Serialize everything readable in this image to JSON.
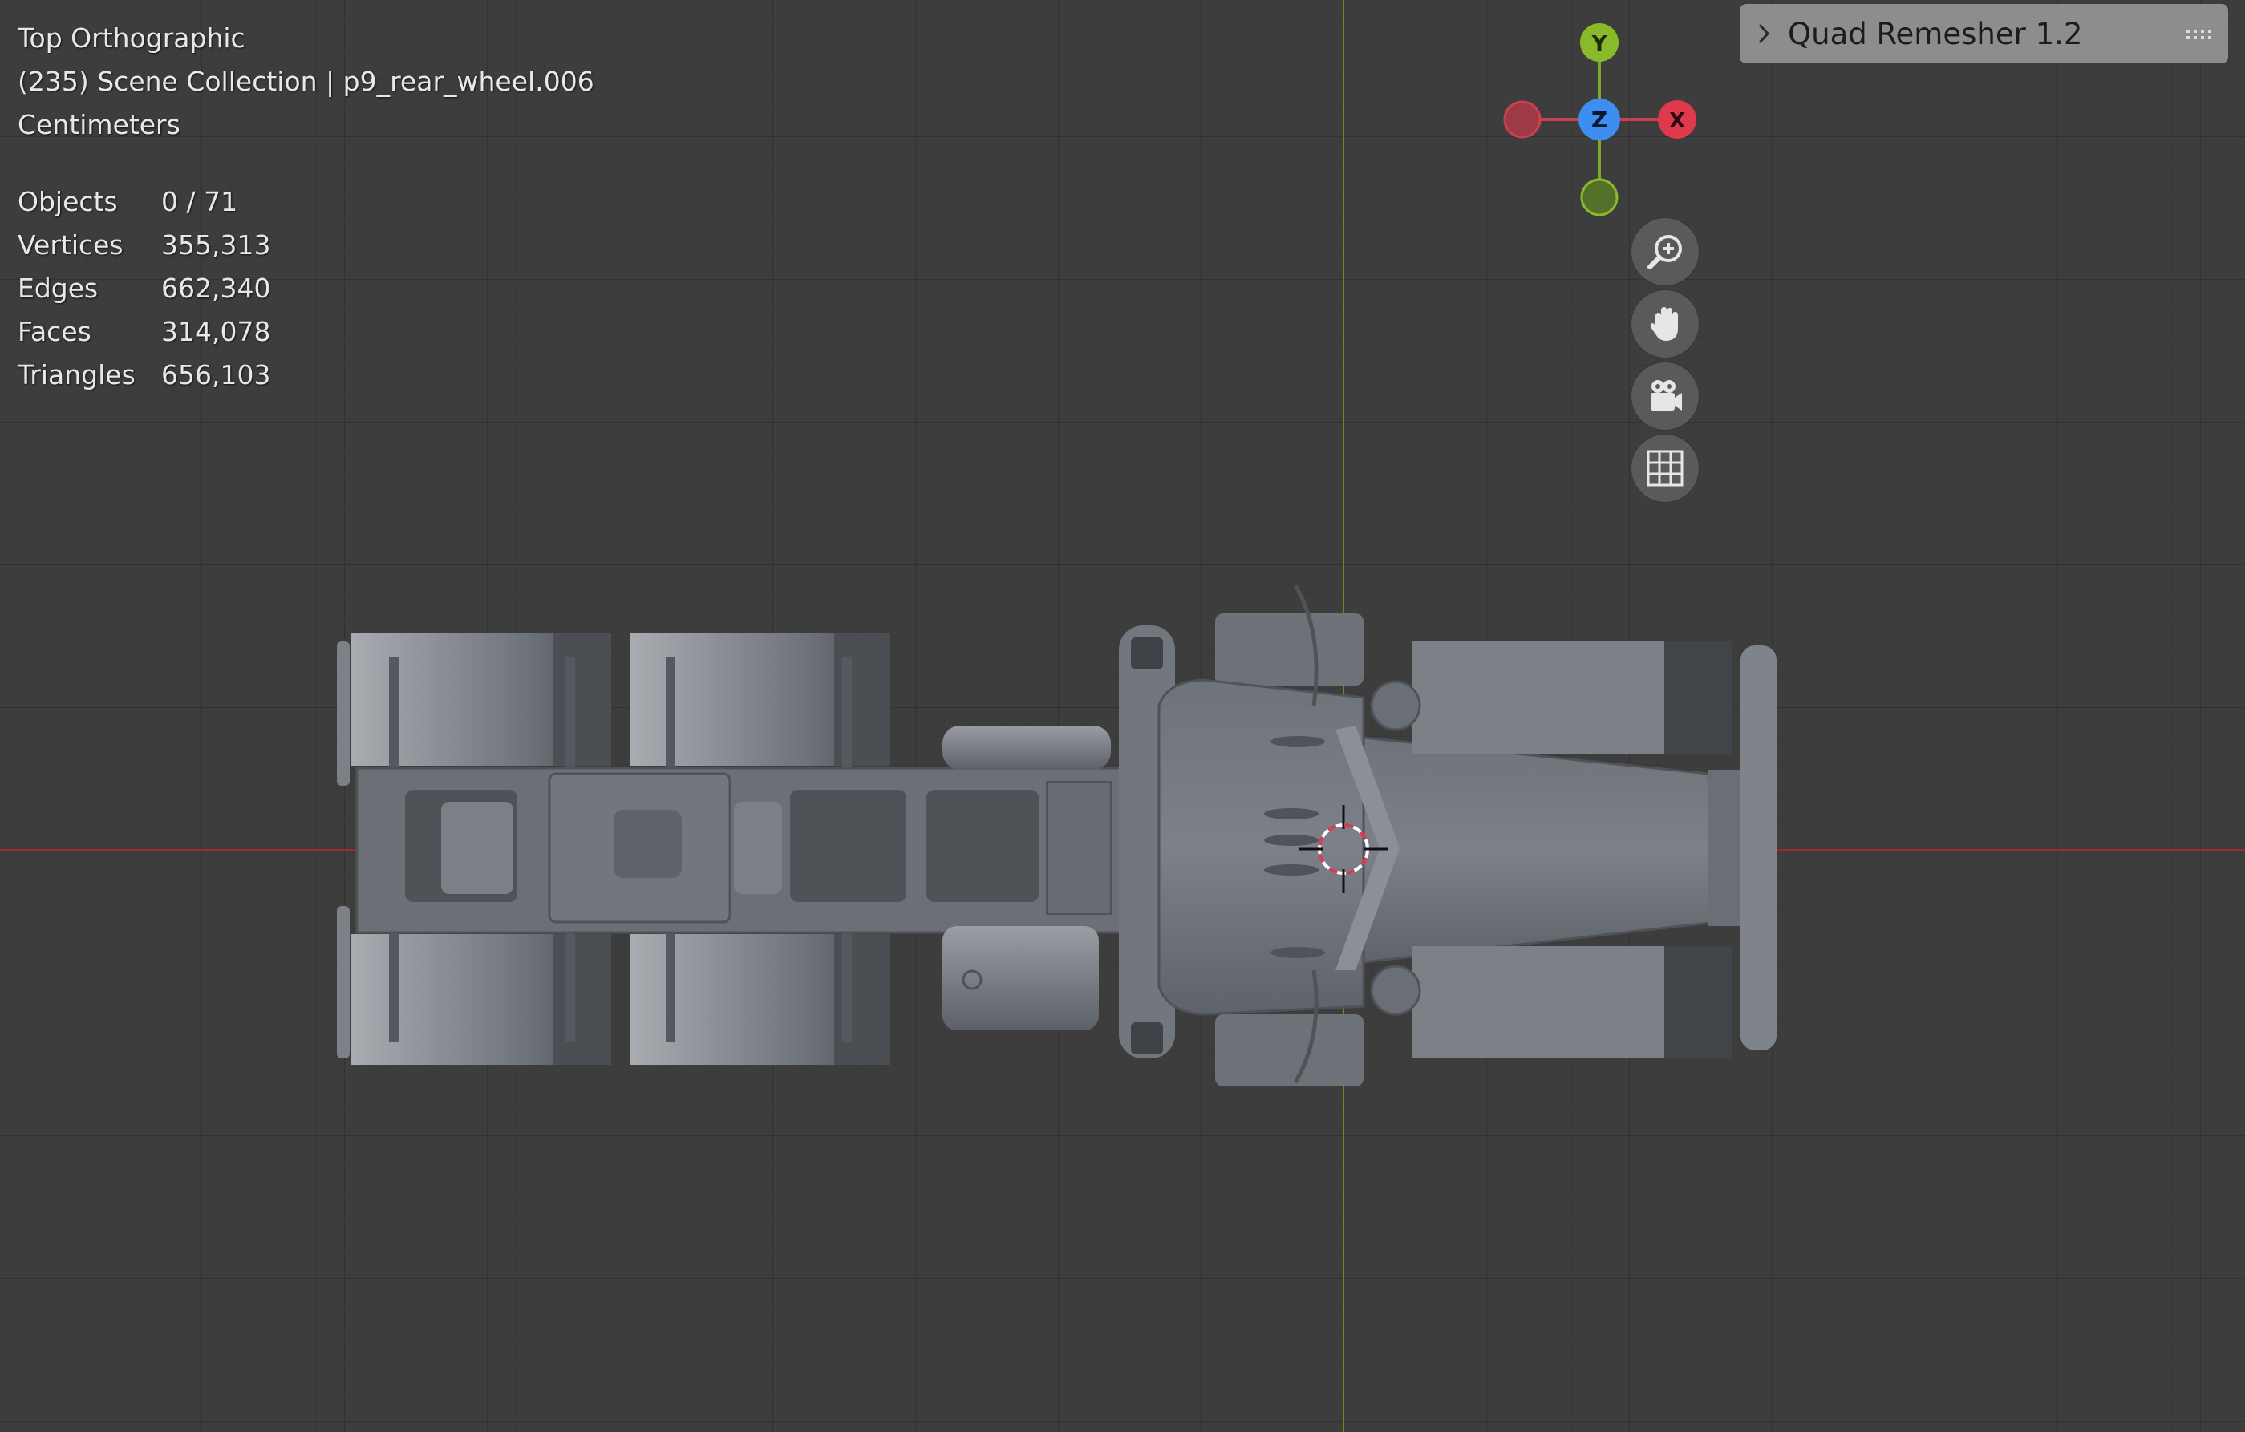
{
  "viewport": {
    "view_name": "Top Orthographic",
    "collection_info": "(235) Scene Collection | p9_rear_wheel.006",
    "units": "Centimeters"
  },
  "statistics": [
    {
      "label": "Objects",
      "value": "0 / 71"
    },
    {
      "label": "Vertices",
      "value": "355,313"
    },
    {
      "label": "Edges",
      "value": "662,340"
    },
    {
      "label": "Faces",
      "value": "314,078"
    },
    {
      "label": "Triangles",
      "value": "656,103"
    }
  ],
  "gizmo": {
    "y_label": "Y",
    "z_label": "Z",
    "x_label": "X",
    "colors": {
      "x": "#e0384c",
      "y": "#8ab92a",
      "z": "#3d8ef0"
    }
  },
  "nav_buttons": [
    {
      "name": "zoom",
      "icon": "zoom-in-icon"
    },
    {
      "name": "pan",
      "icon": "hand-icon"
    },
    {
      "name": "camera",
      "icon": "camera-icon"
    },
    {
      "name": "ortho-toggle",
      "icon": "grid-icon"
    }
  ],
  "panel": {
    "title": "Quad Remesher 1.2"
  },
  "colors": {
    "background": "#3d3d3d",
    "x_axis": "#9a2b33",
    "y_axis": "#6a8c22",
    "panel": "#8d8d8d"
  }
}
